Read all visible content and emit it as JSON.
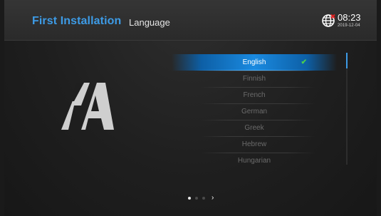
{
  "header": {
    "title": "First Installation",
    "subtitle": "Language",
    "time": "08:23",
    "date": "2019-12-04",
    "globe_icon": "globe-icon"
  },
  "languages": {
    "items": [
      {
        "label": "English",
        "selected": true
      },
      {
        "label": "Finnish",
        "selected": false
      },
      {
        "label": "French",
        "selected": false
      },
      {
        "label": "German",
        "selected": false
      },
      {
        "label": "Greek",
        "selected": false
      },
      {
        "label": "Hebrew",
        "selected": false
      },
      {
        "label": "Hungarian",
        "selected": false
      }
    ],
    "check_mark": "✔"
  },
  "pager": {
    "pages": 3,
    "current": 1,
    "next_glyph": "›"
  },
  "colors": {
    "accent": "#3d9be6",
    "selection": "#1a8ae0",
    "check": "#4cd04c",
    "background": "#1f1f1f"
  }
}
